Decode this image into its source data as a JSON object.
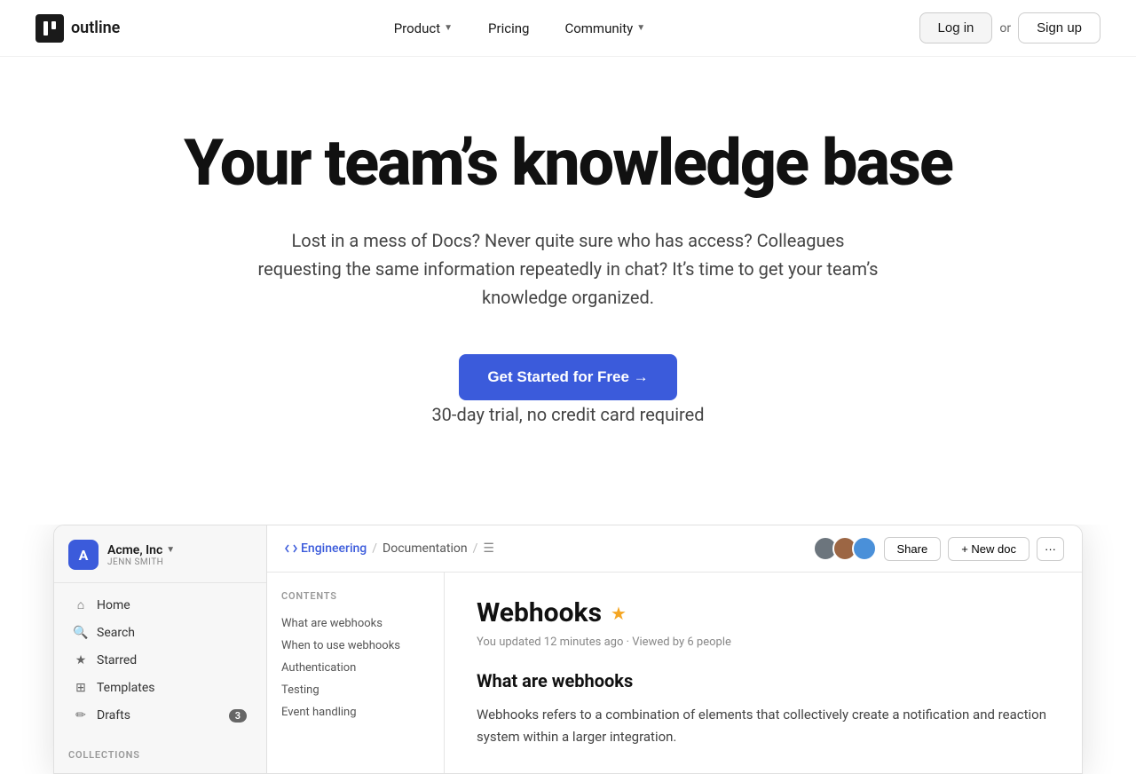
{
  "nav": {
    "logo_text": "outline",
    "links": [
      {
        "label": "Product",
        "has_dropdown": true
      },
      {
        "label": "Pricing",
        "has_dropdown": false
      },
      {
        "label": "Community",
        "has_dropdown": true
      }
    ],
    "login_label": "Log in",
    "or_text": "or",
    "signup_label": "Sign up"
  },
  "hero": {
    "headline": "Your team’s knowledge base",
    "subtext": "Lost in a mess of Docs? Never quite sure who has access? Colleagues requesting the same information repeatedly in chat? It’s time to get your team’s knowledge organized.",
    "cta_label": "Get Started for Free →",
    "trial_text": "30-day trial, no credit card required"
  },
  "sidebar": {
    "workspace_name": "Acme, Inc",
    "workspace_user": "JENN SMITH",
    "avatar_letter": "A",
    "nav_items": [
      {
        "label": "Home",
        "icon": "home"
      },
      {
        "label": "Search",
        "icon": "search"
      },
      {
        "label": "Starred",
        "icon": "star"
      },
      {
        "label": "Templates",
        "icon": "template"
      },
      {
        "label": "Drafts",
        "icon": "draft",
        "badge": "3"
      }
    ],
    "section_label": "COLLECTIONS"
  },
  "toolbar": {
    "breadcrumb_code": "Engineering",
    "breadcrumb_doc": "Documentation",
    "share_label": "Share",
    "new_doc_label": "+ New doc",
    "more_label": "..."
  },
  "toc": {
    "label": "CONTENTS",
    "items": [
      "What are webhooks",
      "When to use webhooks",
      "Authentication",
      "Testing",
      "Event handling"
    ]
  },
  "doc": {
    "title": "Webhooks",
    "meta": "You updated 12 minutes ago · Viewed by 6 people",
    "section_title": "What are webhooks",
    "body_text": "Webhooks refers to a combination of elements that collectively create a notification and reaction system within a larger integration."
  }
}
